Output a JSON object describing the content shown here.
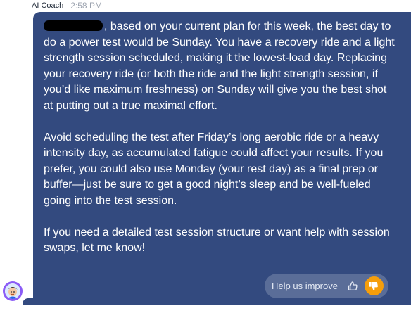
{
  "message": {
    "sender": "AI Coach",
    "time": "2:58 PM",
    "paragraphs": [
      ", based on your current plan for this week, the best day to do a power test would be Sunday. You have a recovery ride and a light strength session scheduled, making it the lowest-load day. Replacing your recovery ride (or both the ride and the light strength session, if you’d like maximum freshness) on Sunday will give you the best shot at putting out a true maximal effort.",
      "Avoid scheduling the test after Friday’s long aerobic ride or a heavy intensity day, as accumulated fatigue could affect your results. If you prefer, you could also use Monday (your rest day) as a final prep or buffer—just be sure to get a good night’s sleep and be well-fueled going into the test session.",
      "If you need a detailed test session structure or want help with session swaps, let me know!"
    ]
  },
  "feedback": {
    "label": "Help us improve",
    "thumbs_up_icon": "thumbs-up-icon",
    "thumbs_down_icon": "thumbs-down-icon",
    "accent_color": "#f59e0b"
  },
  "colors": {
    "bubble": "#334a7f",
    "text": "#ffffff"
  },
  "avatar_icon": "coach-avatar-icon"
}
